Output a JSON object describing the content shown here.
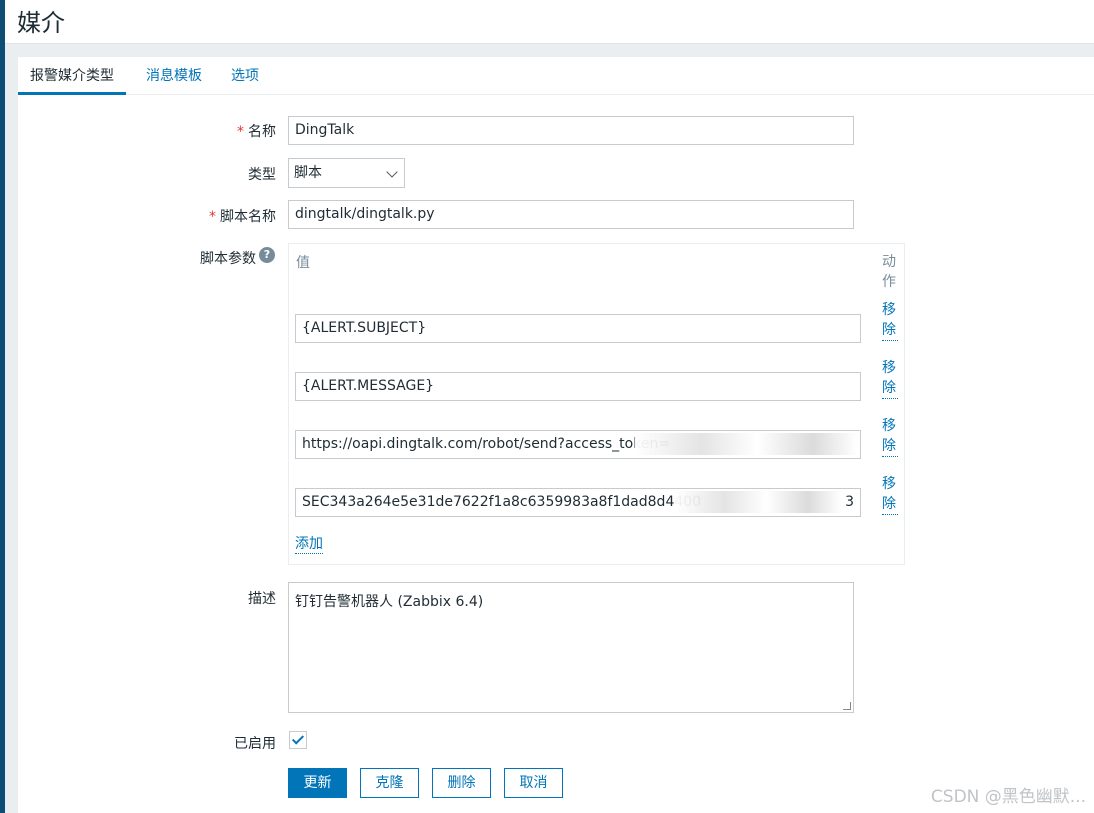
{
  "page": {
    "title": "媒介"
  },
  "tabs": [
    {
      "label": "报警媒介类型",
      "active": true
    },
    {
      "label": "消息模板",
      "active": false
    },
    {
      "label": "选项",
      "active": false
    }
  ],
  "form": {
    "name": {
      "label": "名称",
      "required_mark": "*",
      "value": "DingTalk"
    },
    "type": {
      "label": "类型",
      "value": "脚本"
    },
    "script_name": {
      "label": "脚本名称",
      "required_mark": "*",
      "value": "dingtalk/dingtalk.py"
    },
    "script_params": {
      "label": "脚本参数",
      "help_icon": "question-circle-icon",
      "col_value": "值",
      "col_action": "动作",
      "rows": [
        {
          "value": "{ALERT.SUBJECT}",
          "remove": "移除"
        },
        {
          "value": "{ALERT.MESSAGE}",
          "remove": "移除"
        },
        {
          "value": "https://oapi.dingtalk.com/robot/send?access_token=",
          "remove": "移除"
        },
        {
          "value": "SEC343a264e5e31de7622f1a8c6359983a8f1dad8d4400",
          "suffix": "3",
          "remove": "移除"
        }
      ],
      "add": "添加"
    },
    "description": {
      "label": "描述",
      "value": "钉钉告警机器人 (Zabbix 6.4)"
    },
    "enabled": {
      "label": "已启用",
      "checked": true
    }
  },
  "buttons": {
    "update": "更新",
    "clone": "克隆",
    "delete": "删除",
    "cancel": "取消"
  },
  "watermark": "CSDN @黑色幽默..."
}
